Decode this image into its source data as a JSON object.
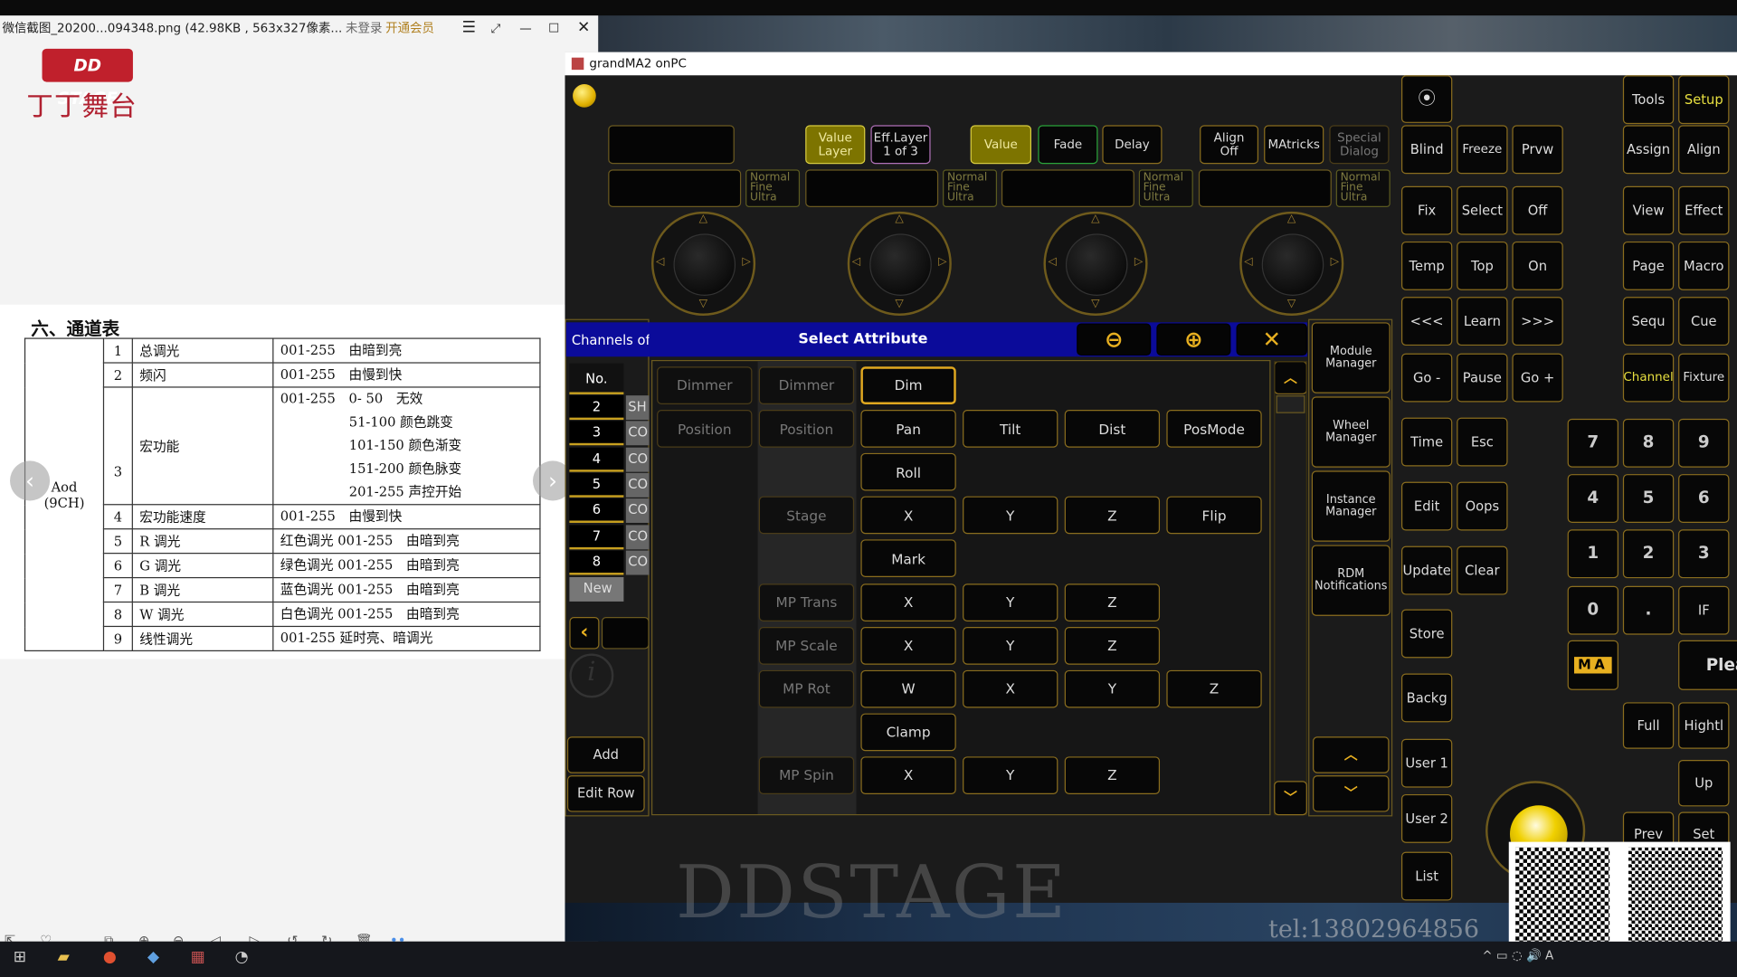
{
  "viewer": {
    "title": "微信截图_20200...094348.png (42.98KB , 563x327像素...",
    "login_status": "未登录",
    "vip_label": "开通会员"
  },
  "logo": {
    "brand": "DD STAGE",
    "cn": "丁丁舞台"
  },
  "document": {
    "heading": "六、通道表",
    "fixture_name": "Aod",
    "fixture_mode": "(9CH)",
    "rows": [
      {
        "no": "1",
        "name": "总调光",
        "desc": [
          "001-255　由暗到亮"
        ]
      },
      {
        "no": "2",
        "name": "频闪",
        "desc": [
          "001-255　由慢到快"
        ]
      },
      {
        "no": "3",
        "name": "宏功能",
        "desc": [
          "001-255　0- 50　无效",
          "51-100 颜色跳变",
          "101-150 颜色渐变",
          "151-200 颜色脉变",
          "201-255 声控开始"
        ]
      },
      {
        "no": "4",
        "name": "宏功能速度",
        "desc": [
          "001-255　由慢到快"
        ]
      },
      {
        "no": "5",
        "name": "R 调光",
        "desc": [
          "红色调光 001-255　由暗到亮"
        ]
      },
      {
        "no": "6",
        "name": "G 调光",
        "desc": [
          "绿色调光 001-255　由暗到亮"
        ]
      },
      {
        "no": "7",
        "name": "B 调光",
        "desc": [
          "蓝色调光 001-255　由暗到亮"
        ]
      },
      {
        "no": "8",
        "name": "W 调光",
        "desc": [
          "白色调光 001-255　由暗到亮"
        ]
      },
      {
        "no": "9",
        "name": "线性调光",
        "desc": [
          "001-255 延时亮、暗调光"
        ]
      }
    ]
  },
  "grandma": {
    "title": "grandMA2 onPC",
    "encoder_bar": [
      {
        "label": "Value\nLayer",
        "style": "yel"
      },
      {
        "label": "Eff.Layer\n1 of 3",
        "style": "pur"
      },
      {
        "label": "Value",
        "style": "yel"
      },
      {
        "label": "Fade",
        "style": "grn"
      },
      {
        "label": "Delay",
        "style": ""
      },
      {
        "label": "Align\nOff",
        "style": ""
      },
      {
        "label": "MAtricks",
        "style": ""
      },
      {
        "label": "Special\nDialog",
        "style": "dim"
      }
    ],
    "resolution_label": "Normal\nFine\nUltra",
    "channels": {
      "title": "Channels of",
      "col_no": "No.",
      "rows": [
        {
          "no": "2",
          "type": "SH"
        },
        {
          "no": "3",
          "type": "CO"
        },
        {
          "no": "4",
          "type": "CO"
        },
        {
          "no": "5",
          "type": "CO"
        },
        {
          "no": "6",
          "type": "CO"
        },
        {
          "no": "7",
          "type": "CO"
        },
        {
          "no": "8",
          "type": "CO"
        }
      ],
      "new_label": "New",
      "add": "Add",
      "edit_row": "Edit Row"
    },
    "dialog": {
      "title": "Select Attribute",
      "rows": [
        [
          "Dimmer",
          "Dimmer",
          "Dim",
          "",
          "",
          ""
        ],
        [
          "Position",
          "Position",
          "Pan",
          "Tilt",
          "Dist",
          "PosMode"
        ],
        [
          "",
          "",
          "Roll",
          "",
          "",
          ""
        ],
        [
          "",
          "Stage",
          "X",
          "Y",
          "Z",
          "Flip"
        ],
        [
          "",
          "",
          "Mark",
          "",
          "",
          ""
        ],
        [
          "",
          "MP Trans",
          "X",
          "Y",
          "Z",
          ""
        ],
        [
          "",
          "MP Scale",
          "X",
          "Y",
          "Z",
          ""
        ],
        [
          "",
          "MP Rot",
          "W",
          "X",
          "Y",
          "Z"
        ],
        [
          "",
          "",
          "Clamp",
          "",
          "",
          ""
        ],
        [
          "",
          "MP Spin",
          "X",
          "Y",
          "Z",
          ""
        ]
      ],
      "selected": "Dim"
    },
    "managers": [
      "Module\nManager",
      "Wheel\nManager",
      "Instance\nManager",
      "RDM\nNotifications"
    ],
    "keys": [
      "Blind",
      "Freeze",
      "Prvw",
      "Fix",
      "Select",
      "Off",
      "Temp",
      "Top",
      "On",
      "<<<",
      "Learn",
      ">>>",
      "Go -",
      "Pause",
      "Go +",
      "Time",
      "Esc",
      "Edit",
      "Oops",
      "Update",
      "Clear",
      "Store",
      "Backg",
      "User 1",
      "User 2",
      "List",
      "Tools",
      "Setup",
      "Assign",
      "Align",
      "View",
      "Effect",
      "Page",
      "Macro",
      "Sequ",
      "Cue",
      "Channel",
      "Fixture",
      "7",
      "8",
      "9",
      "4",
      "5",
      "6",
      "1",
      "2",
      "3",
      "0",
      ".",
      "IF",
      "Plea",
      "Full",
      "Hightl",
      "Up",
      "Prev",
      "Set"
    ],
    "highlight_keys": [
      "Setup",
      "Channel"
    ],
    "ma_logo": "MA"
  },
  "watermark": {
    "text": "DDSTAGE",
    "phone": "tel:13802964856"
  },
  "colors": {
    "accent": "#c8a020",
    "dialog_header": "#0b0b9a",
    "active_fill": "#7d7400"
  }
}
